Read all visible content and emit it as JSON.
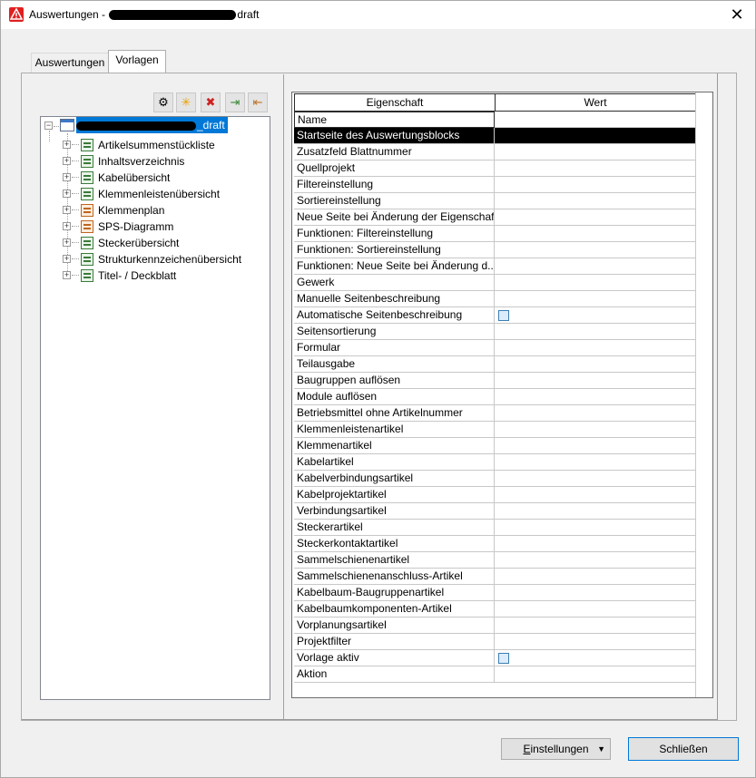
{
  "window": {
    "title_prefix": "Auswertungen - ",
    "title_suffix": "draft",
    "close_glyph": "✕",
    "app_icon": "warning-logo-icon"
  },
  "tabs": [
    {
      "label": "Auswertungen",
      "active": false
    },
    {
      "label": "Vorlagen",
      "active": true
    }
  ],
  "toolbar": {
    "buttons": [
      {
        "icon": "gear-icon",
        "glyph": "⚙"
      },
      {
        "icon": "new-star-icon",
        "glyph": "✳"
      },
      {
        "icon": "delete-icon",
        "glyph": "✖"
      },
      {
        "icon": "import-icon",
        "glyph": "⇥"
      },
      {
        "icon": "export-icon",
        "glyph": "⇤"
      }
    ]
  },
  "tree": {
    "root_label_suffix": "_draft",
    "items": [
      {
        "label": "Artikelsummenstückliste",
        "icon_color": "green"
      },
      {
        "label": "Inhaltsverzeichnis",
        "icon_color": "green"
      },
      {
        "label": "Kabelübersicht",
        "icon_color": "green"
      },
      {
        "label": "Klemmenleistenübersicht",
        "icon_color": "green"
      },
      {
        "label": "Klemmenplan",
        "icon_color": "orange"
      },
      {
        "label": "SPS-Diagramm",
        "icon_color": "orange"
      },
      {
        "label": "Steckerübersicht",
        "icon_color": "green"
      },
      {
        "label": "Strukturkennzeichenübersicht",
        "icon_color": "green"
      },
      {
        "label": "Titel- / Deckblatt",
        "icon_color": "green"
      }
    ]
  },
  "properties": {
    "col_property": "Eigenschaft",
    "col_value": "Wert",
    "rows": [
      {
        "name": "Name",
        "checkbox": false
      },
      {
        "name": "Startseite des Auswertungsblocks",
        "checkbox": false,
        "selected": true
      },
      {
        "name": "Zusatzfeld Blattnummer",
        "checkbox": false
      },
      {
        "name": "Quellprojekt",
        "checkbox": false
      },
      {
        "name": "Filtereinstellung",
        "checkbox": false
      },
      {
        "name": "Sortiereinstellung",
        "checkbox": false
      },
      {
        "name": "Neue Seite bei Änderung der Eigenschaft",
        "checkbox": false
      },
      {
        "name": "Funktionen: Filtereinstellung",
        "checkbox": false
      },
      {
        "name": "Funktionen: Sortiereinstellung",
        "checkbox": false
      },
      {
        "name": "Funktionen: Neue Seite bei Änderung d...",
        "checkbox": false
      },
      {
        "name": "Gewerk",
        "checkbox": false
      },
      {
        "name": "Manuelle Seitenbeschreibung",
        "checkbox": false
      },
      {
        "name": "Automatische Seitenbeschreibung",
        "checkbox": true
      },
      {
        "name": "Seitensortierung",
        "checkbox": false
      },
      {
        "name": "Formular",
        "checkbox": false
      },
      {
        "name": "Teilausgabe",
        "checkbox": false
      },
      {
        "name": "Baugruppen auflösen",
        "checkbox": false
      },
      {
        "name": "Module auflösen",
        "checkbox": false
      },
      {
        "name": "Betriebsmittel ohne Artikelnummer",
        "checkbox": false
      },
      {
        "name": "Klemmenleistenartikel",
        "checkbox": false
      },
      {
        "name": "Klemmenartikel",
        "checkbox": false
      },
      {
        "name": "Kabelartikel",
        "checkbox": false
      },
      {
        "name": "Kabelverbindungsartikel",
        "checkbox": false
      },
      {
        "name": "Kabelprojektartikel",
        "checkbox": false
      },
      {
        "name": "Verbindungsartikel",
        "checkbox": false
      },
      {
        "name": "Steckerartikel",
        "checkbox": false
      },
      {
        "name": "Steckerkontaktartikel",
        "checkbox": false
      },
      {
        "name": "Sammelschienenartikel",
        "checkbox": false
      },
      {
        "name": "Sammelschienenanschluss-Artikel",
        "checkbox": false
      },
      {
        "name": "Kabelbaum-Baugruppenartikel",
        "checkbox": false
      },
      {
        "name": "Kabelbaumkomponenten-Artikel",
        "checkbox": false
      },
      {
        "name": "Vorplanungsartikel",
        "checkbox": false
      },
      {
        "name": "Projektfilter",
        "checkbox": false
      },
      {
        "name": "Vorlage aktiv",
        "checkbox": true
      },
      {
        "name": "Aktion",
        "checkbox": false
      }
    ]
  },
  "buttons": {
    "settings_label": "Einstellungen",
    "settings_dropdown_glyph": "▼",
    "close_label": "Schließen"
  }
}
